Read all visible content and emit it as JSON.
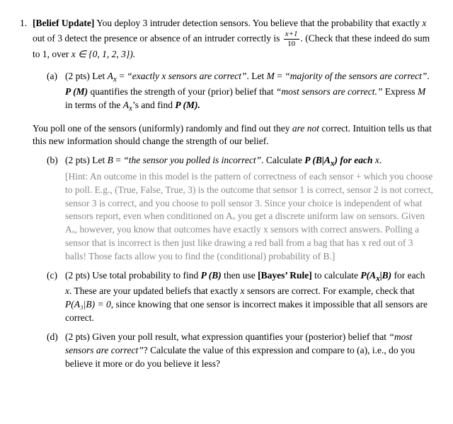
{
  "problem_number": "1.",
  "title": "[Belief Update]",
  "intro1": "You deploy 3 intruder detection sensors. You believe that the probability that exactly ",
  "intro_var1": "x",
  "intro2": " out of 3 detect the presence or absence of an intruder correctly is ",
  "frac_top": "x+1",
  "frac_bot": "10",
  "intro3": ". (Check that these indeed do sum to 1, over ",
  "intro_set": "x ∈ {0, 1, 2, 3}).",
  "parts": {
    "a": {
      "label": "(a)",
      "pts": "(2 pts)",
      "t1": "Let ",
      "t2": "A",
      "t2sub": "x",
      "t3": " = ",
      "t4": "“exactly x sensors are correct”",
      "t5": ". Let ",
      "t6": "M",
      "t7": " = ",
      "t8": "“majority of the sensors are correct”",
      "t9": ". ",
      "t10": "P (M)",
      "t11": " quantifies the strength of your (prior) belief that ",
      "t12": "“most sensors are correct.”",
      "t13": " Express ",
      "t14": "M",
      "t15": " in terms of the ",
      "t16": "A",
      "t16sub": "x",
      "t17": "’s and find ",
      "t18": "P (M)."
    }
  },
  "mid1": "You poll one of the sensors (uniformly) randomly and find out they ",
  "mid2": "are not",
  "mid3": " correct. Intuition tells us that this new information should change the strength of our belief.",
  "b": {
    "label": "(b)",
    "pts": "(2 pts)",
    "t1": "Let ",
    "t2": "B",
    "t3": " = ",
    "t4": "“the sensor you polled is incorrect”",
    "t5": ". Calculate ",
    "t6": "P (B|A",
    "t6sub": "x",
    "t7": ") for each ",
    "t8": "x",
    "t9": ".",
    "hint": "[Hint: An outcome in this model is the pattern of correctness of each sensor + which you choose to poll. E.g., (True, False, True, 3) is the outcome that sensor 1 is correct, sensor 2 is not correct, sensor 3 is correct, and you choose to poll sensor 3. Since your choice is independent of what sensors report, even when conditioned on Aₓ you get a discrete uniform law on sensors. Given Aₓ, however, you know that outcomes have exactly x sensors with correct answers. Polling a sensor that is incorrect is then just like drawing a red ball from a bag that has x red out of 3 balls! Those facts allow you to find the (conditional) probability of B.]"
  },
  "c": {
    "label": "(c)",
    "pts": "(2 pts)",
    "t1": "Use total probability to find ",
    "t2": "P (B)",
    "t3": " then use ",
    "t4": "[Bayes’ Rule]",
    "t5": " to calculate ",
    "t6": "P(A",
    "t6sub": "x",
    "t7": "|B)",
    "t8": " for each ",
    "t9": "x",
    "t10": ". These are your updated beliefs that exactly ",
    "t11": "x",
    "t12": " sensors are correct. For example, check that ",
    "t13": "P(A₃|B) = 0",
    "t14": ", since knowing that one sensor is incorrect makes it impossible that all sensors are correct."
  },
  "d": {
    "label": "(d)",
    "pts": "(2 pts)",
    "t1": "Given your poll result, what expression quantifies your (posterior) belief that ",
    "t2": "“most sensors are correct”",
    "t3": "? Calculate the value of this expression and compare to (a), i.e., do you believe it more or do you believe it less?"
  }
}
